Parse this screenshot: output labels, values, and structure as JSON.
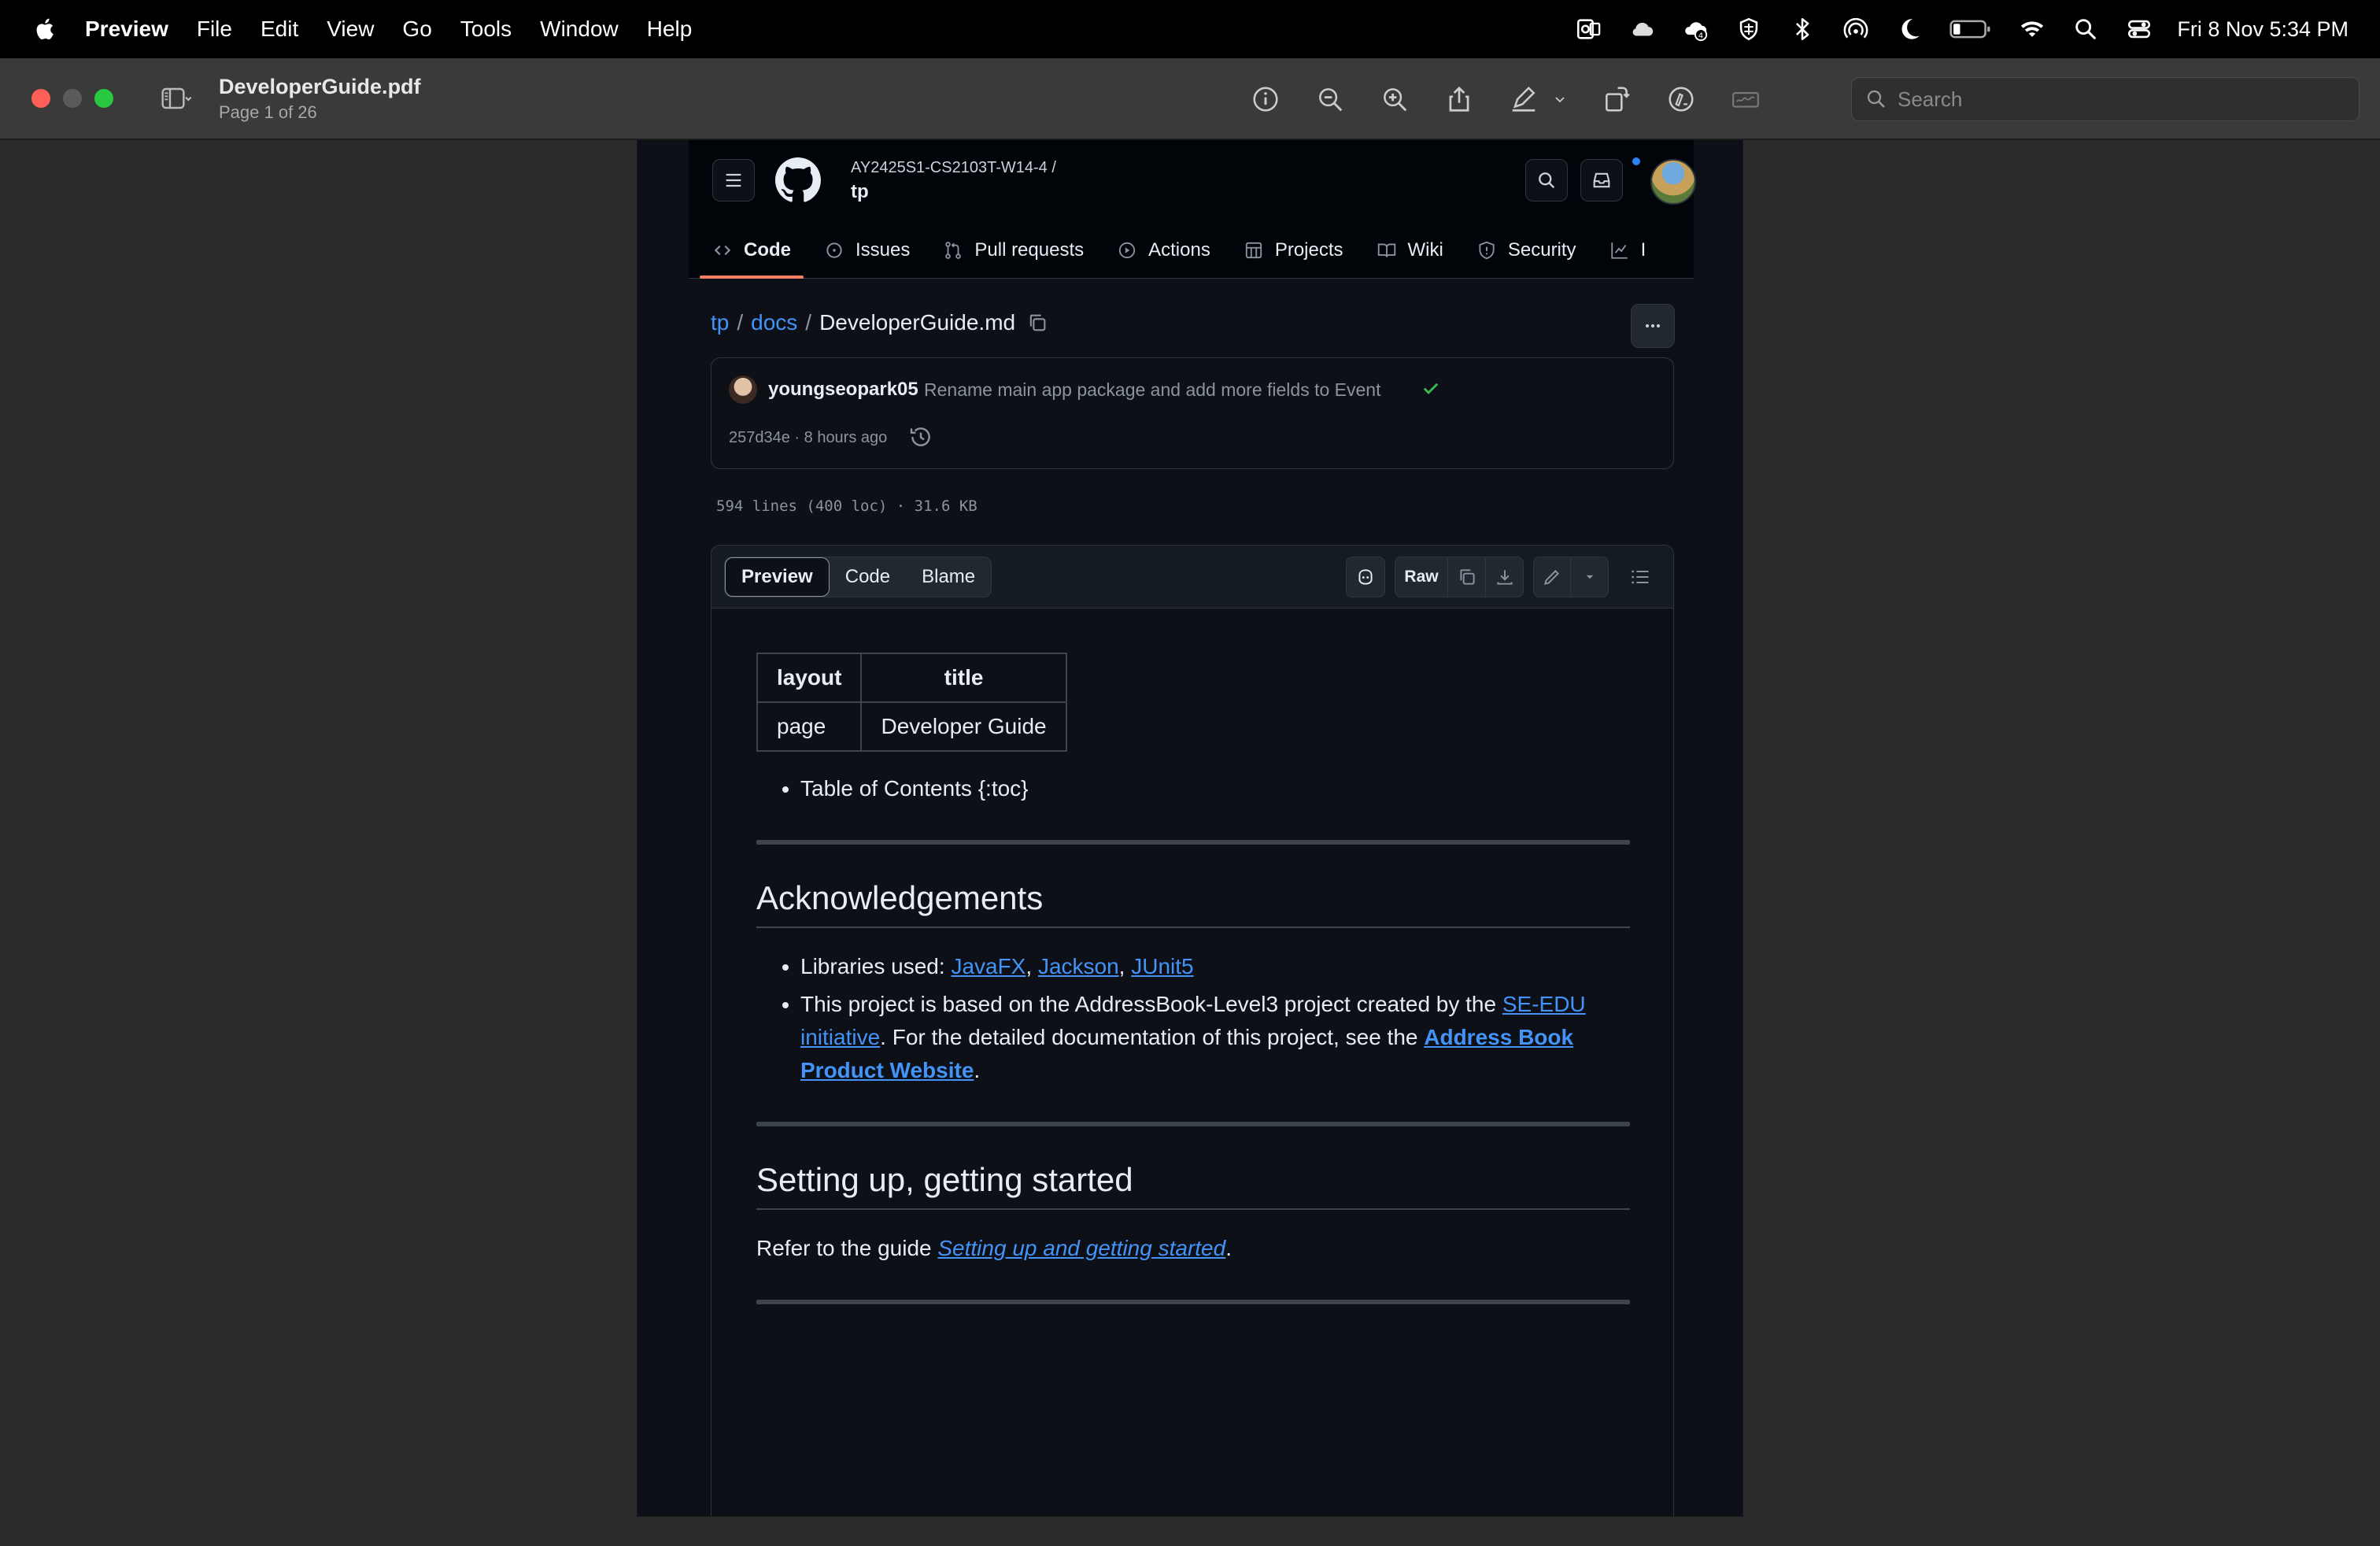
{
  "menubar": {
    "items": [
      "Preview",
      "File",
      "Edit",
      "View",
      "Go",
      "Tools",
      "Window",
      "Help"
    ],
    "clock": "Fri 8 Nov  5:34 PM",
    "status_icons": [
      "outlook-icon",
      "cloud-icon",
      "creative-cloud-icon",
      "vpn-icon",
      "bluetooth-icon",
      "airdrop-icon",
      "moon-icon",
      "battery-icon",
      "wifi-icon",
      "spotlight-icon",
      "control-center-icon"
    ]
  },
  "toolbar": {
    "doc_title": "DeveloperGuide.pdf",
    "doc_subtitle": "Page 1 of 26",
    "search_placeholder": "Search"
  },
  "github": {
    "repo_owner": "AY2425S1-CS2103T-W14-4 /",
    "repo_name": "tp",
    "tabs": [
      {
        "label": "Code",
        "icon": "code-icon"
      },
      {
        "label": "Issues",
        "icon": "issue-icon"
      },
      {
        "label": "Pull requests",
        "icon": "pull-request-icon"
      },
      {
        "label": "Actions",
        "icon": "actions-icon"
      },
      {
        "label": "Projects",
        "icon": "projects-icon"
      },
      {
        "label": "Wiki",
        "icon": "wiki-icon"
      },
      {
        "label": "Security",
        "icon": "shield-icon"
      },
      {
        "label": "I",
        "icon": "graph-icon"
      }
    ],
    "breadcrumb": {
      "root": "tp",
      "folder": "docs",
      "file": "DeveloperGuide.md",
      "sep": "/"
    },
    "commit": {
      "author": "youngseopark05",
      "message": "Rename main app package and add more fields to Event",
      "meta": "257d34e · 8 hours ago"
    },
    "file_stats": "594 lines (400 loc) · 31.6 KB",
    "view_tabs": [
      "Preview",
      "Code",
      "Blame"
    ],
    "raw_label": "Raw"
  },
  "markdown": {
    "table": {
      "headers": [
        "layout",
        "title"
      ],
      "row": [
        "page",
        "Developer Guide"
      ]
    },
    "toc_item": "Table of Contents {:toc}",
    "ack": {
      "heading": "Acknowledgements",
      "libs_prefix": "Libraries used: ",
      "libs": [
        "JavaFX",
        "Jackson",
        "JUnit5"
      ],
      "lib_sep": ", ",
      "project_prefix": "This project is based on the AddressBook-Level3 project created by the ",
      "project_link1": "SE-EDU initiative",
      "project_mid": ". For the detailed documentation of this project, see the ",
      "project_link2": "Address Book Product Website",
      "project_end": "."
    },
    "setup": {
      "heading": "Setting up, getting started",
      "text_prefix": "Refer to the guide ",
      "link": "Setting up and getting started",
      "text_end": "."
    }
  },
  "colors": {
    "github_bg": "#0d1117",
    "link": "#4493f8",
    "active_tab_underline": "#f78166",
    "toolbar_bg": "#3a3a3a"
  }
}
